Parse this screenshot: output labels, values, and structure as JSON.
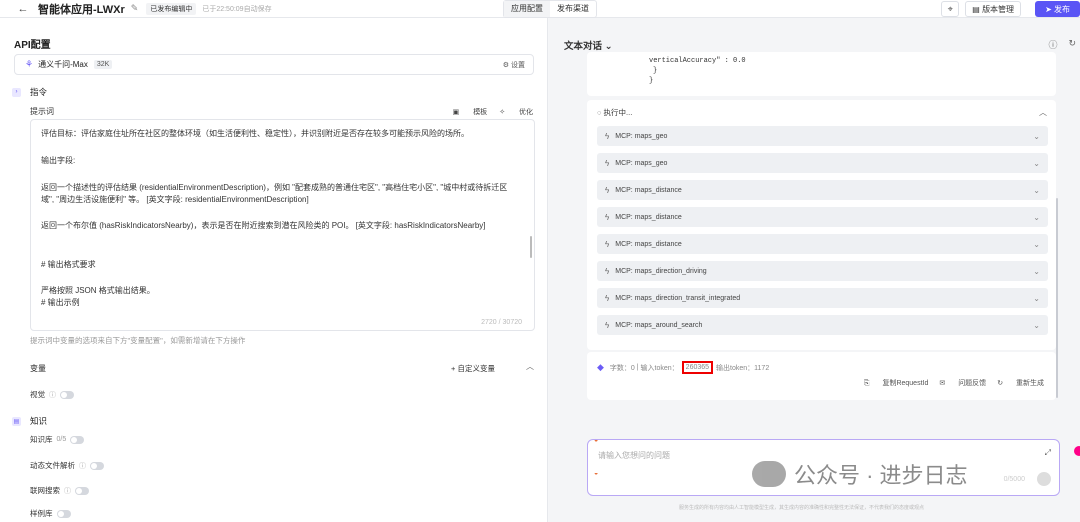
{
  "header": {
    "title": "智能体应用-LWXr",
    "publish_status": "已发布编辑中",
    "autosave": "已于22:50:09自动保存",
    "tabs": [
      {
        "label": "应用配置"
      },
      {
        "label": "发布渠道"
      }
    ],
    "version_label": "版本管理",
    "publish_label": "发布"
  },
  "left": {
    "section_title": "API配置",
    "model": {
      "name": "通义千问-Max",
      "context": "32K",
      "settings_label": "设置"
    },
    "instruction_label": "指令",
    "prompt_label": "提示词",
    "template_label": "模板",
    "optimize_label": "优化",
    "prompt_lines": [
      "评估目标：评估家庭住址所在社区的整体环境（如生活便利性、稳定性），并识别附近是否存在较多可能预示风险的场所。",
      "输出字段:",
      "返回一个描述性的评估结果 (residentialEnvironmentDescription)，例如 \"配套成熟的普通住宅区\", \"高档住宅小区\", \"城中村或待拆迁区",
      "域\", \"周边生活设施便利\" 等。 [英文字段: residentialEnvironmentDescription]",
      "返回一个布尔值 (hasRiskIndicatorsNearby)，表示是否在附近搜索到潜在风险类的 POI。 [英文字段: hasRiskIndicatorsNearby]",
      "# 输出格式要求",
      "严格按照 JSON 格式输出结果。",
      "# 输出示例"
    ],
    "prompt_count": "2720 / 30720",
    "hint": "提示词中变量的选项来自下方\"变量配置\"，如需新增请在下方操作",
    "variables_label": "变量",
    "custom_var_label": "+ 自定义变量",
    "vision_label": "视觉",
    "knowledge_label": "知识",
    "kb_label": "知识库",
    "kb_count": "0/5",
    "dynamic_file_label": "动态文件解析",
    "web_search_label": "联网搜索",
    "sample_label": "样例库"
  },
  "right": {
    "title": "文本对话",
    "code_lines": [
      "verticalAccuracy\" : 0.0",
      "}",
      "}"
    ],
    "exec_label": "执行中...",
    "mcp_prefix": "MCP:",
    "mcp_calls": [
      {
        "name": "maps_geo"
      },
      {
        "name": "maps_geo"
      },
      {
        "name": "maps_distance"
      },
      {
        "name": "maps_distance"
      },
      {
        "name": "maps_distance"
      },
      {
        "name": "maps_direction_driving"
      },
      {
        "name": "maps_direction_transit_integrated"
      },
      {
        "name": "maps_around_search"
      }
    ],
    "stats": {
      "chars": "字数：0",
      "input_label": "输入token：",
      "input_tokens": "260365",
      "output": "输出token：1172"
    },
    "copy_label": "复制RequestId",
    "feedback_label": "问题反馈",
    "regen_label": "重新生成",
    "input_placeholder": "请输入您想问的问题",
    "input_counter": "0/5000",
    "disclaimer": "服务生成的所有内容均由人工智能模型生成，其生成内容的准确性和完整性无法保证，不代表我们的态度或观点"
  },
  "watermark": {
    "text": "公众号 · 进步日志"
  },
  "colors": {
    "accent": "#5a55f5",
    "highlight": "#e00000"
  },
  "icons": [
    "back-icon",
    "edit-icon",
    "locate-icon",
    "version-icon",
    "send-icon",
    "info-icon",
    "refresh-icon",
    "bolt-icon",
    "chevron-down-icon",
    "chevron-up-icon",
    "expand-icon"
  ]
}
